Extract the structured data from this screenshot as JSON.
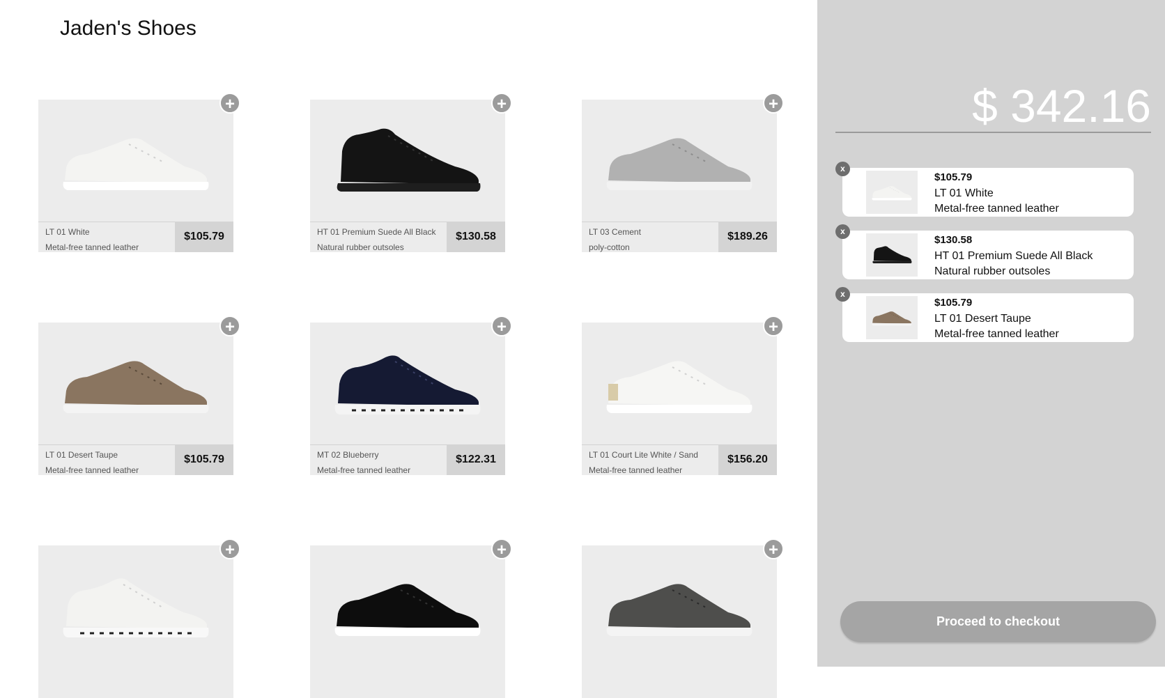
{
  "store": {
    "title": "Jaden's Shoes"
  },
  "colors": {
    "card_bg": "#ececec",
    "price_bg": "#d4d4d4",
    "sidebar_bg": "#d3d3d3",
    "checkout_bg": "#a5a5a5",
    "add_button": "#9b9b9b"
  },
  "products": [
    {
      "name": "LT 01 White",
      "material": "Metal-free tanned leather",
      "price": "$105.79",
      "add_icon": "plus-icon"
    },
    {
      "name": "HT 01 Premium Suede All Black",
      "material": "Natural rubber outsoles",
      "price": "$130.58",
      "add_icon": "plus-icon"
    },
    {
      "name": "LT 03 Cement",
      "material": "poly-cotton",
      "price": "$189.26",
      "add_icon": "plus-icon"
    },
    {
      "name": "LT 01 Desert Taupe",
      "material": "Metal-free tanned leather",
      "price": "$105.79",
      "add_icon": "plus-icon"
    },
    {
      "name": "MT 02 Blueberry",
      "material": "Metal-free tanned leather",
      "price": "$122.31",
      "add_icon": "plus-icon"
    },
    {
      "name": "LT 01 Court Lite White / Sand",
      "material": "Metal-free tanned leather",
      "price": "$156.20",
      "add_icon": "plus-icon"
    },
    {
      "add_icon": "plus-icon"
    },
    {
      "add_icon": "plus-icon"
    },
    {
      "add_icon": "plus-icon"
    }
  ],
  "cart": {
    "total": "$ 342.16",
    "remove_label": "x",
    "items": [
      {
        "price": "$105.79",
        "name": "LT 01 White",
        "material": "Metal-free tanned leather"
      },
      {
        "price": "$130.58",
        "name": "HT 01 Premium Suede All Black",
        "material": "Natural rubber outsoles"
      },
      {
        "price": "$105.79",
        "name": "LT 01 Desert Taupe",
        "material": "Metal-free tanned leather"
      }
    ],
    "checkout_label": "Proceed to checkout"
  }
}
